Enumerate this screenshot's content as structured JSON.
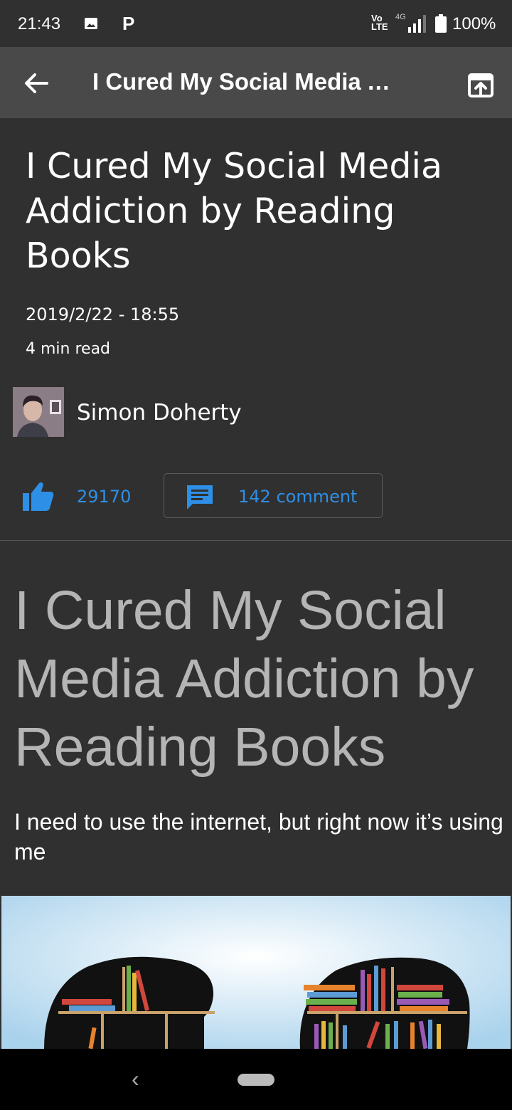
{
  "status_bar": {
    "time": "21:43",
    "parking_icon": "P",
    "network_volte": "Vo\nLTE",
    "network_type": "4G",
    "battery": "100%"
  },
  "toolbar": {
    "title": "I Cured My Social Media Addiction by Reading Books",
    "back_icon": "arrow-left-icon",
    "open_icon": "open-in-browser-icon"
  },
  "article": {
    "title": "I Cured My Social Media Addiction by Reading Books",
    "date": "2019/2/22 - 18:55",
    "read_time": "4 min read",
    "author": "Simon Doherty",
    "likes": "29170",
    "comments": "142 comment"
  },
  "body": {
    "heading": "I Cured My Social Media Addiction by Reading Books",
    "subtitle": "I need to use the internet, but right now it’s using me"
  },
  "nav": {
    "back_glyph": "‹"
  },
  "colors": {
    "background": "#303030",
    "toolbar": "#494949",
    "accent": "#2e8fe6",
    "heading_gray": "#b5b5b5"
  }
}
